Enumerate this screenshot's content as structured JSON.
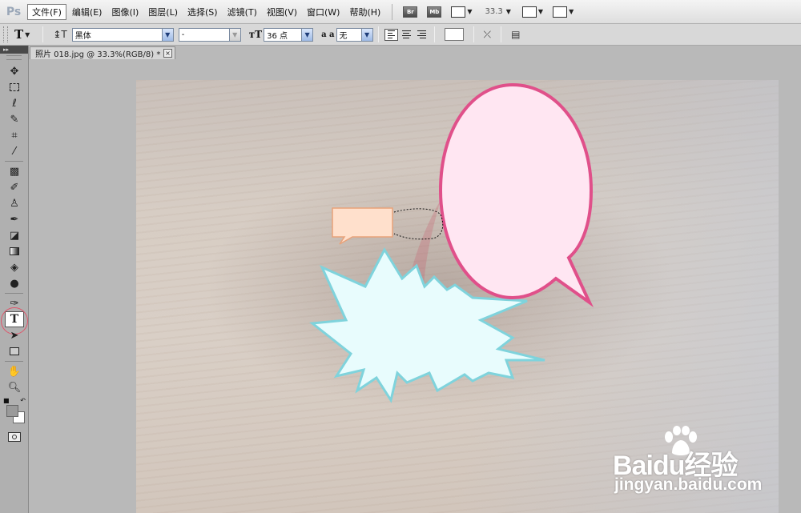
{
  "app": {
    "logo": "Ps"
  },
  "menu": {
    "items": [
      "文件(F)",
      "编辑(E)",
      "图像(I)",
      "图层(L)",
      "选择(S)",
      "滤镜(T)",
      "视图(V)",
      "窗口(W)",
      "帮助(H)"
    ],
    "bridge_label": "Br",
    "minibridge_label": "Mb",
    "zoom": "33.3"
  },
  "options": {
    "font_family": "黑体",
    "font_style": "-",
    "font_size": "36 点",
    "antialias_label": "a a",
    "antialias": "无"
  },
  "document": {
    "tab_title": "照片 018.jpg @ 33.3%(RGB/8) *",
    "close_glyph": "×"
  },
  "colors": {
    "oval_fill": "#ffe6f2",
    "oval_stroke": "#e0508a",
    "starburst_fill": "#e8fcfd",
    "starburst_stroke": "#7fd3dc",
    "rect_fill": "#ffe0cc",
    "rect_stroke": "#e8a27a"
  },
  "watermark": {
    "logo": "Baidu经验",
    "url": "jingyan.baidu.com"
  }
}
